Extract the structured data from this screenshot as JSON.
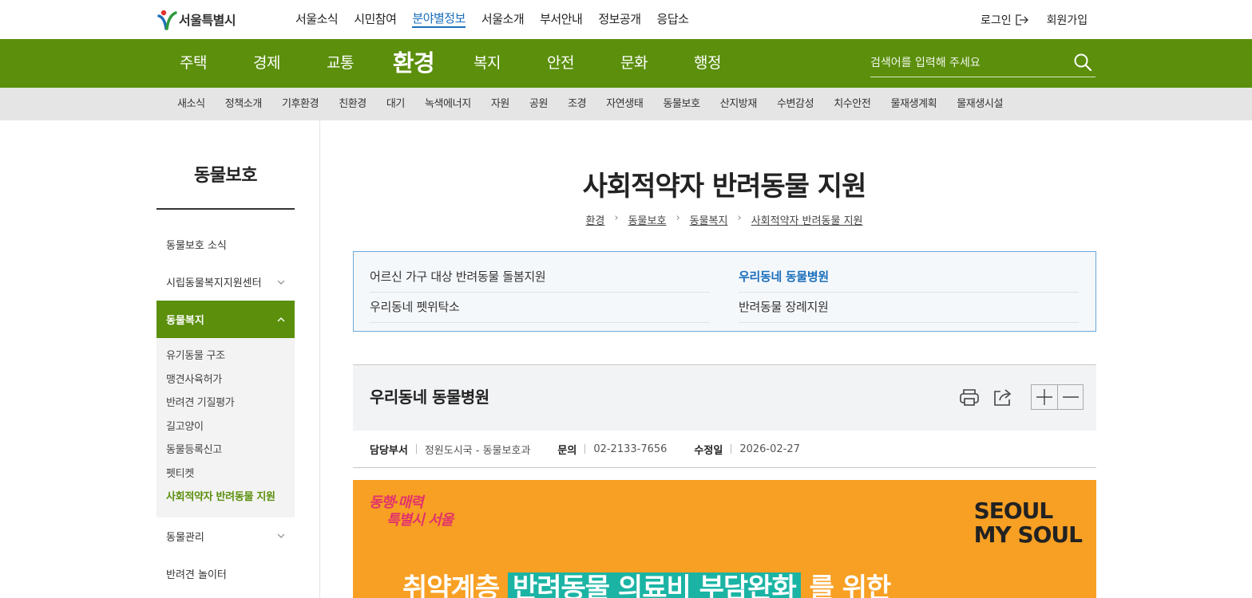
{
  "header": {
    "logo_text": "서울특별시",
    "gnb": [
      {
        "label": "서울소식",
        "active": false
      },
      {
        "label": "시민참여",
        "active": false
      },
      {
        "label": "분야별정보",
        "active": true
      },
      {
        "label": "서울소개",
        "active": false
      },
      {
        "label": "부서안내",
        "active": false
      },
      {
        "label": "정보공개",
        "active": false
      },
      {
        "label": "응답소",
        "active": false
      }
    ],
    "login_label": "로그인",
    "signup_label": "회원가입"
  },
  "category_nav": {
    "tabs": [
      "주택",
      "경제",
      "교통",
      "환경",
      "복지",
      "안전",
      "문화",
      "행정"
    ],
    "current": "환경",
    "search_placeholder": "검색어를 입력해 주세요"
  },
  "sub_nav": [
    "새소식",
    "정책소개",
    "기후환경",
    "친환경",
    "대기",
    "녹색에너지",
    "자원",
    "공원",
    "조경",
    "자연생태",
    "동물보호",
    "산지방재",
    "수변감성",
    "치수안전",
    "물재생계획",
    "물재생시설"
  ],
  "sidebar": {
    "title": "동물보호",
    "items": [
      {
        "label": "동물보호 소식"
      },
      {
        "label": "시립동물복지지원센터"
      },
      {
        "label": "동물복지"
      },
      {
        "label": "동물관리"
      },
      {
        "label": "반려견 놀이터"
      }
    ],
    "sub_items": [
      "유기동물 구조",
      "맹견사육허가",
      "반려견 기질평가",
      "길고양이",
      "동물등록신고",
      "펫티켓",
      "사회적약자 반려동물 지원"
    ],
    "current_sub": "사회적약자 반려동물 지원"
  },
  "page": {
    "title": "사회적약자 반려동물 지원",
    "breadcrumb": [
      "환경",
      "동물보호",
      "동물복지",
      "사회적약자 반려동물 지원"
    ],
    "links": [
      {
        "label": "어르신 가구 대상 반려동물 돌봄지원",
        "active": false
      },
      {
        "label": "우리동네 동물병원",
        "active": true
      },
      {
        "label": "우리동네 펫위탁소",
        "active": false
      },
      {
        "label": "반려동물 장례지원",
        "active": false
      }
    ]
  },
  "article": {
    "title": "우리동네 동물병원",
    "meta": {
      "dept_label": "담당부서",
      "dept_value": "정원도시국 - 동물보호과",
      "contact_label": "문의",
      "contact_value": "02-2133-7656",
      "modified_label": "수정일",
      "modified_value": "2026-02-27"
    }
  },
  "banner": {
    "slogan_line1": "동행·매력",
    "slogan_line2": "특별시 서울",
    "logo_line1": "SEOUL",
    "logo_line2": "MY SOUL",
    "headline_pre": "취약계층",
    "headline_highlight": "반려동물 의료비 부담완화",
    "headline_post": "를 위한",
    "bg_color": "#f7a024",
    "highlight_color": "#1bb4a4",
    "slogan_color": "#e2336b"
  },
  "colors": {
    "green": "#5b8f0c",
    "link_blue": "#1a6fbc"
  }
}
